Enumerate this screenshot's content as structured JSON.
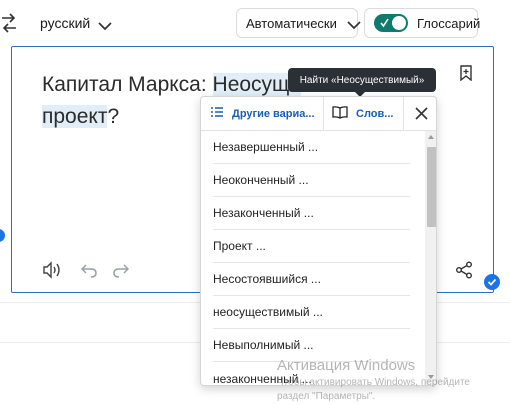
{
  "header": {
    "target_language": "русский",
    "auto_select_label": "Автоматически",
    "glossary_label": "Глоссарий"
  },
  "editor": {
    "text_before": "Капитал Маркса: ",
    "text_highlight_1": "Неосуще",
    "text_highlight_2": "проект",
    "text_after": "?"
  },
  "tooltip": {
    "text": "Найти «Неосуществимый»"
  },
  "popup": {
    "tab_alternatives": "Другие вариа...",
    "tab_dictionary": "Слов...",
    "items": [
      "Незавершенный ...",
      "Неоконченный ...",
      "Незаконченный ...",
      "Проект ...",
      "Несостоявшийся ...",
      "неосуществимый ...",
      "Невыполнимый ...",
      "незаконченный ..."
    ]
  },
  "watermark": {
    "title": "Активация Windows",
    "line1": "Чтобы активировать Windows, перейдите",
    "line2": "раздел \"Параметры\"."
  },
  "colors": {
    "accent": "#1a5fb4",
    "toggle_on": "#0f7b6c",
    "highlight": "#e1eef7",
    "tooltip_bg": "#2b2f36"
  },
  "icons": {
    "swap": "swap-languages-icon",
    "chevron": "chevron-down-icon",
    "check": "check-icon",
    "bookmark": "bookmark-icon",
    "speaker": "speaker-icon",
    "undo": "undo-icon",
    "redo": "redo-icon",
    "share": "share-icon",
    "list": "list-icon",
    "book": "book-icon",
    "close": "close-icon"
  }
}
